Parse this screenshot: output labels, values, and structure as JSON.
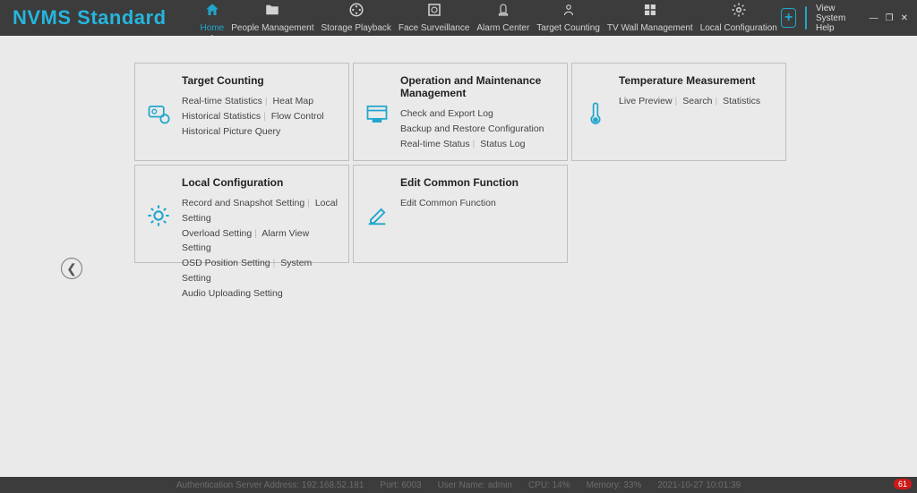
{
  "brand": "NVMS Standard",
  "nav": [
    {
      "label": "Home"
    },
    {
      "label": "People Management"
    },
    {
      "label": "Storage Playback"
    },
    {
      "label": "Face Surveillance"
    },
    {
      "label": "Alarm Center"
    },
    {
      "label": "Target Counting"
    },
    {
      "label": "TV Wall Management"
    },
    {
      "label": "Local Configuration"
    }
  ],
  "syshelp": "View System Help",
  "cards": {
    "target_counting": {
      "title": "Target Counting",
      "links": [
        "Real-time Statistics",
        "Heat Map",
        "Historical Statistics",
        "Flow Control",
        "Historical Picture Query"
      ]
    },
    "omm": {
      "title": "Operation and Maintenance Management",
      "links": [
        "Check and Export Log",
        "Backup and Restore Configuration",
        "Real-time Status",
        "Status Log"
      ]
    },
    "temp": {
      "title": "Temperature Measurement",
      "links": [
        "Live Preview",
        "Search",
        "Statistics"
      ]
    },
    "local": {
      "title": "Local Configuration",
      "links": [
        "Record and Snapshot Setting",
        "Local Setting",
        "Overload Setting",
        "Alarm View Setting",
        "OSD Position Setting",
        "System Setting",
        "Audio Uploading Setting"
      ]
    },
    "edit": {
      "title": "Edit Common Function",
      "links": [
        "Edit Common Function"
      ]
    }
  },
  "status": {
    "auth": "Authentication Server  Address: 192.168.52.181",
    "port": "Port: 6003",
    "user": "User Name: admin",
    "cpu": "CPU: 14%",
    "mem": "Memory: 33%",
    "time": "2021-10-27 10:01:39",
    "badge": "61"
  }
}
